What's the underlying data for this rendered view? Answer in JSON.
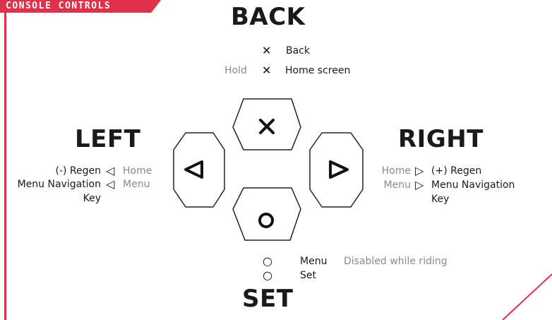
{
  "header": {
    "tag": "CONSOLE CONTROLS"
  },
  "colors": {
    "accent": "#e0304a",
    "muted": "#8a8a8a",
    "text": "#1a1a1a"
  },
  "back": {
    "title": "BACK",
    "row1_label": "Back",
    "row2_prefix": "Hold",
    "row2_label": "Home screen",
    "icon": "x-icon"
  },
  "left": {
    "title": "LEFT",
    "row1_label": "(-) Regen",
    "row1_alt": "Home",
    "row2_label": "Menu Navigation",
    "row2_cont": "Key",
    "row2_alt": "Menu",
    "icon": "triangle-left-icon"
  },
  "right": {
    "title": "RIGHT",
    "row1_alt": "Home",
    "row1_label": "(+) Regen",
    "row2_alt": "Menu",
    "row2_label": "Menu Navigation",
    "row2_cont": "Key",
    "icon": "triangle-right-icon"
  },
  "set": {
    "title": "SET",
    "row1_label": "Menu",
    "row1_note": "Disabled while riding",
    "row2_label": "Set",
    "icon": "circle-icon"
  }
}
